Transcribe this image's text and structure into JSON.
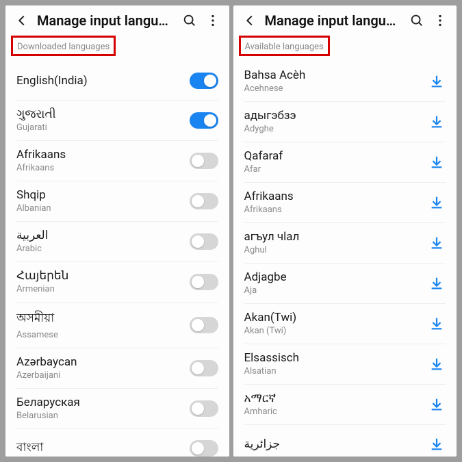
{
  "left": {
    "title": "Manage input langua…",
    "section": "Downloaded languages",
    "items": [
      {
        "name": "English(India)",
        "sub": "",
        "on": true,
        "showSub": false
      },
      {
        "name": "ગુજરાતી",
        "sub": "Gujarati",
        "on": true,
        "showSub": true
      },
      {
        "name": "Afrikaans",
        "sub": "Afrikaans",
        "on": false,
        "showSub": true
      },
      {
        "name": "Shqip",
        "sub": "Albanian",
        "on": false,
        "showSub": true
      },
      {
        "name": "العربية",
        "sub": "Arabic",
        "on": false,
        "showSub": true
      },
      {
        "name": "Հայերեն",
        "sub": "Armenian",
        "on": false,
        "showSub": true
      },
      {
        "name": "অসমীয়া",
        "sub": "Assamese",
        "on": false,
        "showSub": true
      },
      {
        "name": "Azərbaycan",
        "sub": "Azerbaijani",
        "on": false,
        "showSub": true
      },
      {
        "name": "Беларуская",
        "sub": "Belarusian",
        "on": false,
        "showSub": true
      },
      {
        "name": "বাংলা",
        "sub": "",
        "on": false,
        "showSub": false
      }
    ]
  },
  "right": {
    "title": "Manage input langua…",
    "section": "Available languages",
    "items": [
      {
        "name": "Bahsa Acèh",
        "sub": "Acehnese"
      },
      {
        "name": "адыгэбзэ",
        "sub": "Adyghe"
      },
      {
        "name": "Qafaraf",
        "sub": "Afar"
      },
      {
        "name": "Afrikaans",
        "sub": "Afrikaans"
      },
      {
        "name": "агъул чlал",
        "sub": "Aghul"
      },
      {
        "name": "Adjagbe",
        "sub": "Aja"
      },
      {
        "name": "Akan(Twi)",
        "sub": "Akan (Twi)"
      },
      {
        "name": "Elsassisch",
        "sub": "Alsatian"
      },
      {
        "name": "አማርኛ",
        "sub": "Amharic"
      },
      {
        "name": "جزائرية",
        "sub": ""
      }
    ]
  }
}
